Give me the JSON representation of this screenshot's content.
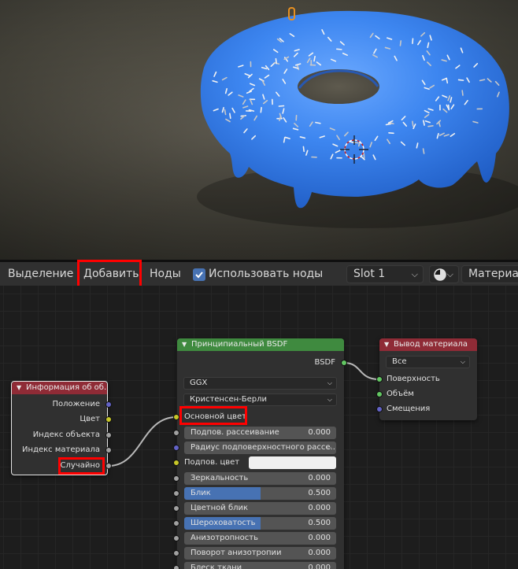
{
  "header": {
    "select_label": "Выделение",
    "add_label": "Добавить",
    "nodes_label": "Ноды",
    "use_nodes_label": "Использовать ноды",
    "use_nodes_checked": true,
    "slot_value": "Slot 1",
    "material_label": "Материал"
  },
  "object_info_node": {
    "title": "Информация об об...",
    "outputs": [
      "Положение",
      "Цвет",
      "Индекс объекта",
      "Индекс материала",
      "Случайно"
    ]
  },
  "bsdf_node": {
    "title": "Принципиальный BSDF",
    "output": "BSDF",
    "distribution": "GGX",
    "subsurface_method": "Кристенсен-Берли",
    "base_color_label": "Основной цвет",
    "subsurface_radius_label": "Радиус подповерхностного рассе...",
    "subsurface_color_label": "Подпов. цвет",
    "sliders": [
      {
        "label": "Подпов. рассеивание",
        "value": "0.000",
        "fill": 0
      },
      {
        "label": "Зеркальность",
        "value": "0.000",
        "fill": 0
      },
      {
        "label": "Блик",
        "value": "0.500",
        "fill": 0.5
      },
      {
        "label": "Цветной блик",
        "value": "0.000",
        "fill": 0
      },
      {
        "label": "Шероховатость",
        "value": "0.500",
        "fill": 0.5
      },
      {
        "label": "Анизотропность",
        "value": "0.000",
        "fill": 0
      },
      {
        "label": "Поворот анизотропии",
        "value": "0.000",
        "fill": 0
      },
      {
        "label": "Блеск ткани",
        "value": "0.000",
        "fill": 0
      }
    ]
  },
  "output_node": {
    "title": "Вывод материала",
    "target": "Все",
    "inputs": [
      "Поверхность",
      "Объём",
      "Смещения"
    ]
  },
  "colors": {
    "header_red": "#8f2b36",
    "header_green": "#3f8a3f",
    "highlight": "#ff0000",
    "accent_blue": "#4772b3"
  }
}
